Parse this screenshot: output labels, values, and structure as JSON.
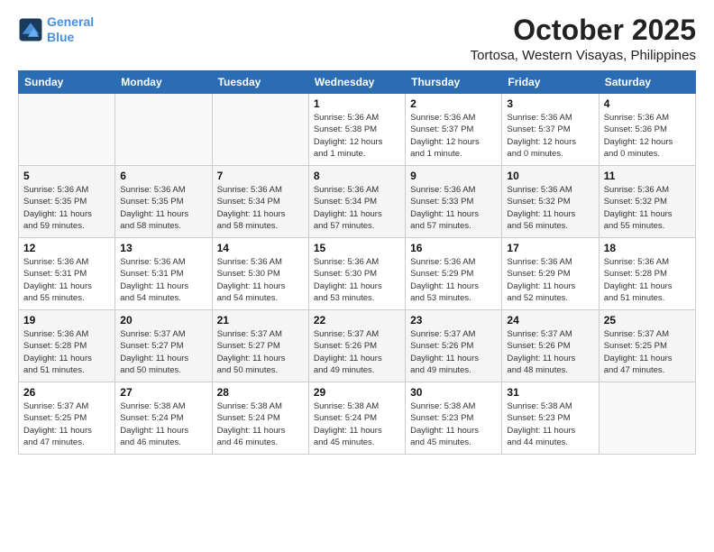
{
  "logo": {
    "line1": "General",
    "line2": "Blue"
  },
  "title": "October 2025",
  "location": "Tortosa, Western Visayas, Philippines",
  "days_of_week": [
    "Sunday",
    "Monday",
    "Tuesday",
    "Wednesday",
    "Thursday",
    "Friday",
    "Saturday"
  ],
  "weeks": [
    [
      {
        "day": "",
        "info": ""
      },
      {
        "day": "",
        "info": ""
      },
      {
        "day": "",
        "info": ""
      },
      {
        "day": "1",
        "info": "Sunrise: 5:36 AM\nSunset: 5:38 PM\nDaylight: 12 hours\nand 1 minute."
      },
      {
        "day": "2",
        "info": "Sunrise: 5:36 AM\nSunset: 5:37 PM\nDaylight: 12 hours\nand 1 minute."
      },
      {
        "day": "3",
        "info": "Sunrise: 5:36 AM\nSunset: 5:37 PM\nDaylight: 12 hours\nand 0 minutes."
      },
      {
        "day": "4",
        "info": "Sunrise: 5:36 AM\nSunset: 5:36 PM\nDaylight: 12 hours\nand 0 minutes."
      }
    ],
    [
      {
        "day": "5",
        "info": "Sunrise: 5:36 AM\nSunset: 5:35 PM\nDaylight: 11 hours\nand 59 minutes."
      },
      {
        "day": "6",
        "info": "Sunrise: 5:36 AM\nSunset: 5:35 PM\nDaylight: 11 hours\nand 58 minutes."
      },
      {
        "day": "7",
        "info": "Sunrise: 5:36 AM\nSunset: 5:34 PM\nDaylight: 11 hours\nand 58 minutes."
      },
      {
        "day": "8",
        "info": "Sunrise: 5:36 AM\nSunset: 5:34 PM\nDaylight: 11 hours\nand 57 minutes."
      },
      {
        "day": "9",
        "info": "Sunrise: 5:36 AM\nSunset: 5:33 PM\nDaylight: 11 hours\nand 57 minutes."
      },
      {
        "day": "10",
        "info": "Sunrise: 5:36 AM\nSunset: 5:32 PM\nDaylight: 11 hours\nand 56 minutes."
      },
      {
        "day": "11",
        "info": "Sunrise: 5:36 AM\nSunset: 5:32 PM\nDaylight: 11 hours\nand 55 minutes."
      }
    ],
    [
      {
        "day": "12",
        "info": "Sunrise: 5:36 AM\nSunset: 5:31 PM\nDaylight: 11 hours\nand 55 minutes."
      },
      {
        "day": "13",
        "info": "Sunrise: 5:36 AM\nSunset: 5:31 PM\nDaylight: 11 hours\nand 54 minutes."
      },
      {
        "day": "14",
        "info": "Sunrise: 5:36 AM\nSunset: 5:30 PM\nDaylight: 11 hours\nand 54 minutes."
      },
      {
        "day": "15",
        "info": "Sunrise: 5:36 AM\nSunset: 5:30 PM\nDaylight: 11 hours\nand 53 minutes."
      },
      {
        "day": "16",
        "info": "Sunrise: 5:36 AM\nSunset: 5:29 PM\nDaylight: 11 hours\nand 53 minutes."
      },
      {
        "day": "17",
        "info": "Sunrise: 5:36 AM\nSunset: 5:29 PM\nDaylight: 11 hours\nand 52 minutes."
      },
      {
        "day": "18",
        "info": "Sunrise: 5:36 AM\nSunset: 5:28 PM\nDaylight: 11 hours\nand 51 minutes."
      }
    ],
    [
      {
        "day": "19",
        "info": "Sunrise: 5:36 AM\nSunset: 5:28 PM\nDaylight: 11 hours\nand 51 minutes."
      },
      {
        "day": "20",
        "info": "Sunrise: 5:37 AM\nSunset: 5:27 PM\nDaylight: 11 hours\nand 50 minutes."
      },
      {
        "day": "21",
        "info": "Sunrise: 5:37 AM\nSunset: 5:27 PM\nDaylight: 11 hours\nand 50 minutes."
      },
      {
        "day": "22",
        "info": "Sunrise: 5:37 AM\nSunset: 5:26 PM\nDaylight: 11 hours\nand 49 minutes."
      },
      {
        "day": "23",
        "info": "Sunrise: 5:37 AM\nSunset: 5:26 PM\nDaylight: 11 hours\nand 49 minutes."
      },
      {
        "day": "24",
        "info": "Sunrise: 5:37 AM\nSunset: 5:26 PM\nDaylight: 11 hours\nand 48 minutes."
      },
      {
        "day": "25",
        "info": "Sunrise: 5:37 AM\nSunset: 5:25 PM\nDaylight: 11 hours\nand 47 minutes."
      }
    ],
    [
      {
        "day": "26",
        "info": "Sunrise: 5:37 AM\nSunset: 5:25 PM\nDaylight: 11 hours\nand 47 minutes."
      },
      {
        "day": "27",
        "info": "Sunrise: 5:38 AM\nSunset: 5:24 PM\nDaylight: 11 hours\nand 46 minutes."
      },
      {
        "day": "28",
        "info": "Sunrise: 5:38 AM\nSunset: 5:24 PM\nDaylight: 11 hours\nand 46 minutes."
      },
      {
        "day": "29",
        "info": "Sunrise: 5:38 AM\nSunset: 5:24 PM\nDaylight: 11 hours\nand 45 minutes."
      },
      {
        "day": "30",
        "info": "Sunrise: 5:38 AM\nSunset: 5:23 PM\nDaylight: 11 hours\nand 45 minutes."
      },
      {
        "day": "31",
        "info": "Sunrise: 5:38 AM\nSunset: 5:23 PM\nDaylight: 11 hours\nand 44 minutes."
      },
      {
        "day": "",
        "info": ""
      }
    ]
  ]
}
